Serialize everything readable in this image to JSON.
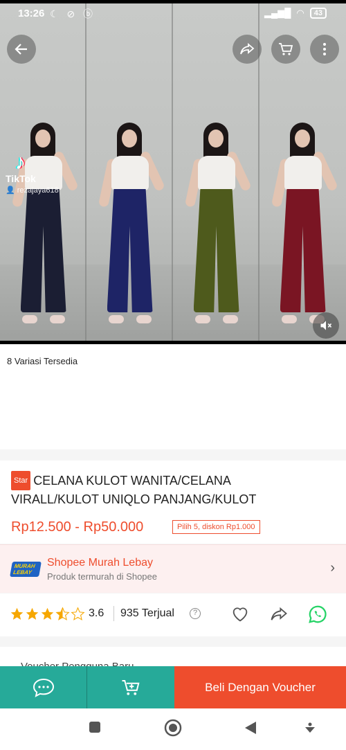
{
  "status_bar": {
    "time": "13:26",
    "battery": "43"
  },
  "hero": {
    "tiktok_brand": "TikTok",
    "tiktok_user": "rezajaya618",
    "pants_colors": [
      "#1b1e33",
      "#1e2466",
      "#4e5a1c",
      "#7a1523"
    ]
  },
  "variations": {
    "label": "8 Variasi Tersedia"
  },
  "product": {
    "badge": "Star",
    "title": "CELANA KULOT WANITA/CELANA VIRALL/KULOT UNIQLO PANJANG/KULOT",
    "price": "Rp12.500 - Rp50.000",
    "discount": "Pilih 5, diskon Rp1.000"
  },
  "shop": {
    "logo_text": "MURAH LEBAY",
    "name": "Shopee Murah Lebay",
    "subtitle": "Produk termurah di Shopee"
  },
  "rating": {
    "value": "3.6",
    "stars": 3.5,
    "sold": "935 Terjual"
  },
  "voucher": {
    "text": "Voucher Pengguna Baru"
  },
  "bottom_bar": {
    "buy_label": "Beli Dengan Voucher"
  },
  "colors": {
    "accent": "#ee4d2d",
    "teal": "#26aa99"
  }
}
